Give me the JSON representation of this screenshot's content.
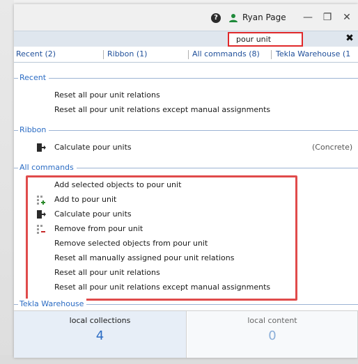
{
  "titlebar": {
    "user_name": "Ryan Page",
    "help_icon": "help-circle-icon",
    "user_icon": "user-icon",
    "minimize_glyph": "—",
    "maximize_glyph": "❐",
    "close_glyph": "✕"
  },
  "search": {
    "value": "pour unit",
    "clear_glyph": "✖"
  },
  "tabs": [
    {
      "label": "Recent (2)"
    },
    {
      "label": "Ribbon (1)"
    },
    {
      "label": "All commands (8)"
    },
    {
      "label": "Tekla Warehouse (1"
    }
  ],
  "sections": {
    "recent": {
      "title": "Recent",
      "items": [
        {
          "label": "Reset all pour unit relations"
        },
        {
          "label": "Reset all pour unit relations except manual assignments"
        }
      ]
    },
    "ribbon": {
      "title": "Ribbon",
      "items": [
        {
          "label": "Calculate pour units",
          "note": "(Concrete)",
          "icon": "calculate-pour-units-icon"
        }
      ]
    },
    "all_commands": {
      "title": "All commands",
      "items": [
        {
          "label": "Add selected objects to pour unit"
        },
        {
          "label": "Add to pour unit",
          "icon": "add-to-pour-unit-icon"
        },
        {
          "label": "Calculate pour units",
          "icon": "calculate-pour-units-icon"
        },
        {
          "label": "Remove from pour unit",
          "icon": "remove-from-pour-unit-icon"
        },
        {
          "label": "Remove selected objects from pour unit"
        },
        {
          "label": "Reset all manually assigned pour unit relations"
        },
        {
          "label": "Reset all pour unit relations"
        },
        {
          "label": "Reset all pour unit relations except manual assignments"
        }
      ]
    },
    "warehouse": {
      "title": "Tekla Warehouse",
      "panels": [
        {
          "title": "local collections",
          "count": "4"
        },
        {
          "title": "local content",
          "count": "0"
        }
      ]
    }
  },
  "colors": {
    "accent": "#2b6cc4",
    "highlight": "#e04b4b",
    "user_green": "#1f8a3a"
  }
}
